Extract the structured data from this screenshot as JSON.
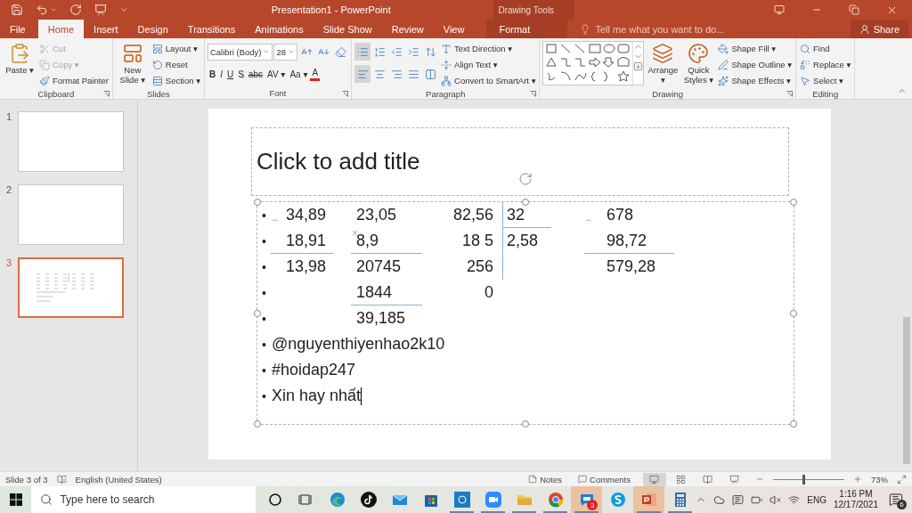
{
  "window": {
    "title": "Presentation1 - PowerPoint",
    "context_label": "Drawing Tools"
  },
  "tabs": [
    {
      "label": "File",
      "selected": false,
      "kind": "file"
    },
    {
      "label": "Home",
      "selected": true,
      "kind": "main"
    },
    {
      "label": "Insert",
      "selected": false,
      "kind": "main"
    },
    {
      "label": "Design",
      "selected": false,
      "kind": "main"
    },
    {
      "label": "Transitions",
      "selected": false,
      "kind": "main"
    },
    {
      "label": "Animations",
      "selected": false,
      "kind": "main"
    },
    {
      "label": "Slide Show",
      "selected": false,
      "kind": "main"
    },
    {
      "label": "Review",
      "selected": false,
      "kind": "main"
    },
    {
      "label": "View",
      "selected": false,
      "kind": "main"
    },
    {
      "label": "Format",
      "selected": false,
      "kind": "context"
    }
  ],
  "tell_me": {
    "placeholder": "Tell me what you want to do..."
  },
  "share": "Share",
  "ribbon": {
    "groups": [
      {
        "label": "Clipboard",
        "launcher": true,
        "columns": [
          [
            {
              "kind": "large",
              "label": "Paste ▾",
              "disabled": false
            }
          ],
          [
            {
              "kind": "small",
              "label": "Cut",
              "disabled": true
            },
            {
              "kind": "small",
              "label": "Copy ▾",
              "disabled": true
            },
            {
              "kind": "small",
              "label": "Format Painter",
              "disabled": false
            }
          ]
        ]
      },
      {
        "label": "Slides",
        "launcher": false,
        "columns": [
          [
            {
              "kind": "large",
              "label": "New Slide ▾"
            }
          ],
          [
            {
              "kind": "small",
              "label": "Layout ▾"
            },
            {
              "kind": "small",
              "label": "Reset"
            },
            {
              "kind": "small",
              "label": "Section ▾"
            }
          ]
        ]
      },
      {
        "label": "Font",
        "launcher": true,
        "columns": [
          [
            {
              "kind": "row",
              "items": [
                {
                  "kind": "select",
                  "value": "Calibri (Body)"
                },
                {
                  "kind": "select",
                  "value": "28"
                },
                {
                  "kind": "icon",
                  "selected": false
                },
                {
                  "kind": "icon",
                  "selected": false
                },
                {
                  "kind": "icon",
                  "selected": false
                }
              ]
            },
            {
              "kind": "row",
              "items": [
                {
                  "kind": "letter",
                  "label": "B"
                },
                {
                  "kind": "letter",
                  "label": "I"
                },
                {
                  "kind": "letter",
                  "label": "U"
                },
                {
                  "kind": "letter",
                  "label": "S"
                },
                {
                  "kind": "letter",
                  "label": "abc"
                },
                {
                  "kind": "letter",
                  "label": "AV ▾"
                },
                {
                  "kind": "letter",
                  "label": "Aa ▾"
                },
                {
                  "kind": "letter",
                  "label": "A"
                }
              ]
            }
          ]
        ]
      },
      {
        "label": "Paragraph",
        "launcher": true,
        "columns": [
          [
            {
              "kind": "row",
              "items": [
                {
                  "kind": "icon",
                  "selected": true
                },
                {
                  "kind": "icon",
                  "selected": false
                },
                {
                  "kind": "icon",
                  "selected": false
                },
                {
                  "kind": "icon",
                  "selected": false
                },
                {
                  "kind": "icon",
                  "selected": false
                }
              ]
            },
            {
              "kind": "row",
              "items": [
                {
                  "kind": "icon",
                  "selected": true
                },
                {
                  "kind": "icon",
                  "selected": false
                },
                {
                  "kind": "icon",
                  "selected": false
                },
                {
                  "kind": "icon",
                  "selected": false
                },
                {
                  "kind": "icon",
                  "selected": false
                }
              ]
            }
          ],
          [
            {
              "kind": "small",
              "label": "Text Direction ▾"
            },
            {
              "kind": "small",
              "label": "Align Text ▾"
            },
            {
              "kind": "small",
              "label": "Convert to SmartArt ▾"
            }
          ]
        ]
      },
      {
        "label": "Drawing",
        "launcher": true,
        "columns": [
          [
            {
              "kind": "gallery"
            }
          ],
          [
            {
              "kind": "large",
              "label": "Arrange ▾"
            }
          ],
          [
            {
              "kind": "large",
              "label": "Quick Styles ▾"
            }
          ],
          [
            {
              "kind": "small",
              "label": "Shape Fill ▾"
            },
            {
              "kind": "small",
              "label": "Shape Outline ▾"
            },
            {
              "kind": "small",
              "label": "Shape Effects ▾"
            }
          ]
        ]
      },
      {
        "label": "Editing",
        "launcher": false,
        "columns": [
          [
            {
              "kind": "small",
              "label": "Find"
            },
            {
              "kind": "small",
              "label": "Replace ▾"
            },
            {
              "kind": "small",
              "label": "Select ▾"
            }
          ]
        ]
      }
    ]
  },
  "thumbnails": [
    {
      "number": "1",
      "selected": false,
      "kind": "blank"
    },
    {
      "number": "2",
      "selected": false,
      "kind": "blank"
    },
    {
      "number": "3",
      "selected": true,
      "kind": "content"
    }
  ],
  "slide": {
    "title_placeholder": "Click to add title",
    "math_rows": [
      {
        "bullet": "•",
        "column_1": {
          "text": "34,89",
          "underlined": false,
          "operator": "−"
        },
        "column_2": {
          "text": "23,05",
          "underlined": false
        },
        "column_3": {
          "text": "82,56",
          "underlined": false
        },
        "column_4": {
          "text": "32",
          "underlined": true
        },
        "column_5": {
          "text": "678",
          "underlined": false,
          "operator": "−"
        }
      },
      {
        "bullet": "•",
        "column_1": {
          "text": "18,91",
          "underlined": true
        },
        "column_2": {
          "text": "8,9",
          "underlined": true,
          "operator": "×"
        },
        "column_3": {
          "text": "18 5",
          "underlined": false
        },
        "column_4": {
          "text": "2,58",
          "underlined": false
        },
        "column_5": {
          "text": "98,72",
          "underlined": true
        }
      },
      {
        "bullet": "•",
        "column_1": {
          "text": "13,98",
          "underlined": false
        },
        "column_2": {
          "text": "20745",
          "underlined": false
        },
        "column_3": {
          "text": "256",
          "underlined": false
        },
        "column_5": {
          "text": "579,28",
          "underlined": false
        }
      },
      {
        "bullet": "•",
        "column_2": {
          "text": "1844",
          "underlined": true
        },
        "column_3": {
          "text": "0",
          "underlined": false
        }
      },
      {
        "bullet": "•",
        "column_2": {
          "text": "39,185",
          "underlined": false
        }
      }
    ],
    "lines": [
      {
        "bullet": "•",
        "text": "@nguyenthiyenhao2k10",
        "caret": false
      },
      {
        "bullet": "•",
        "text": "#hoidap247",
        "caret": false
      },
      {
        "bullet": "•",
        "text": "Xin hay nhất",
        "caret": true
      }
    ]
  },
  "status_bar": {
    "slide_position": "Slide 3 of 3",
    "language": "English (United States)",
    "notes": "Notes",
    "comments": "Comments",
    "views": [
      {
        "selected": true
      },
      {
        "selected": false
      },
      {
        "selected": false
      },
      {
        "selected": false
      }
    ],
    "zoom": {
      "level": 0.42,
      "reading": "73%"
    }
  },
  "taskbar": {
    "search": {
      "placeholder": "Type here to search"
    },
    "apps": [
      {
        "kind": "cortana",
        "running": false,
        "selected": false
      },
      {
        "kind": "task_view",
        "running": false,
        "selected": false
      },
      {
        "kind": "edge",
        "running": false,
        "selected": false
      },
      {
        "kind": "tiktok",
        "running": false,
        "selected": false
      },
      {
        "kind": "mail",
        "running": false,
        "selected": false
      },
      {
        "kind": "store",
        "running": false,
        "selected": false
      },
      {
        "kind": "remote",
        "running": true,
        "selected": false
      },
      {
        "kind": "zoom",
        "running": true,
        "selected": false
      },
      {
        "kind": "explorer",
        "running": true,
        "selected": false
      },
      {
        "kind": "chrome",
        "running": true,
        "selected": false
      },
      {
        "kind": "zalo",
        "running": true,
        "selected": true,
        "badge": "3"
      },
      {
        "kind": "skype",
        "running": false,
        "selected": false
      },
      {
        "kind": "powerpoint",
        "running": true,
        "selected": true
      },
      {
        "kind": "calculator",
        "running": true,
        "selected": false
      }
    ],
    "tray": {
      "language": "ENG",
      "time": "1:16 PM",
      "date": "12/17/2021",
      "notifications": "6"
    }
  }
}
